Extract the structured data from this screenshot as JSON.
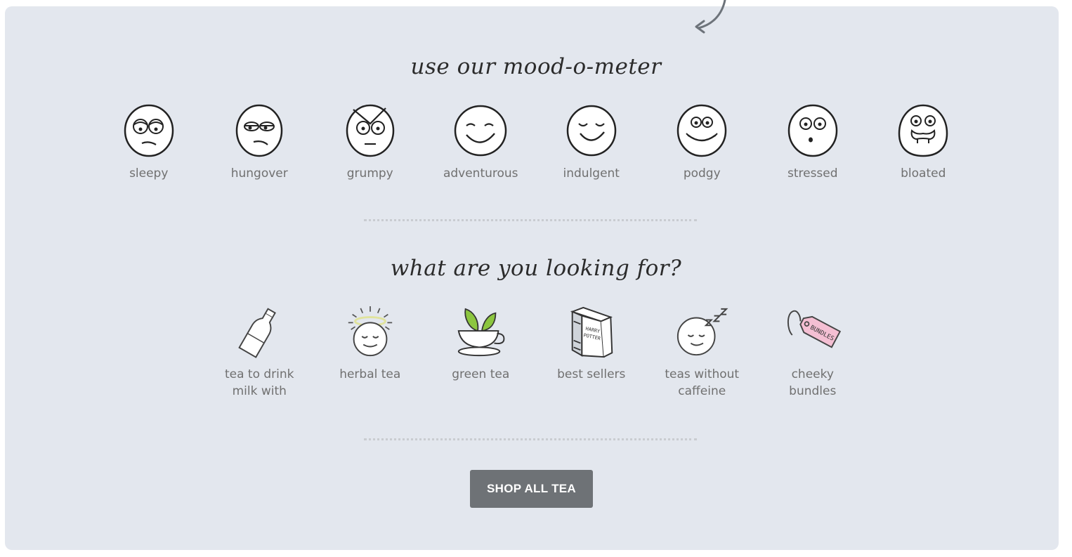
{
  "mood_section": {
    "heading": "use our mood-o-meter",
    "items": [
      {
        "label": "sleepy",
        "icon": "sleepy-face-icon"
      },
      {
        "label": "hungover",
        "icon": "hungover-face-icon"
      },
      {
        "label": "grumpy",
        "icon": "grumpy-face-icon"
      },
      {
        "label": "adventurous",
        "icon": "adventurous-face-icon"
      },
      {
        "label": "indulgent",
        "icon": "indulgent-face-icon"
      },
      {
        "label": "podgy",
        "icon": "podgy-face-icon"
      },
      {
        "label": "stressed",
        "icon": "stressed-face-icon"
      },
      {
        "label": "bloated",
        "icon": "bloated-face-icon"
      }
    ]
  },
  "looking_section": {
    "heading": "what are you looking for?",
    "items": [
      {
        "label": "tea to drink milk with",
        "icon": "milk-bottle-icon"
      },
      {
        "label": "herbal tea",
        "icon": "halo-face-icon"
      },
      {
        "label": "green tea",
        "icon": "teacup-leaves-icon"
      },
      {
        "label": "best sellers",
        "icon": "book-icon"
      },
      {
        "label": "teas without caffeine",
        "icon": "sleeping-face-icon"
      },
      {
        "label": "cheeky bundles",
        "icon": "bundles-tag-icon"
      }
    ],
    "tag_text": "BUNDLES",
    "book_text_line1": "HARRY",
    "book_text_line2": "POTTER"
  },
  "cta": {
    "shop_label": "SHOP ALL TEA"
  },
  "colors": {
    "panel_bg": "#e3e7ee",
    "button_bg": "#6e7276",
    "label_text": "#707070",
    "leaf_green": "#8cc63f",
    "halo_yellow": "#e9edb0",
    "tag_pink": "#f4bfd3"
  }
}
